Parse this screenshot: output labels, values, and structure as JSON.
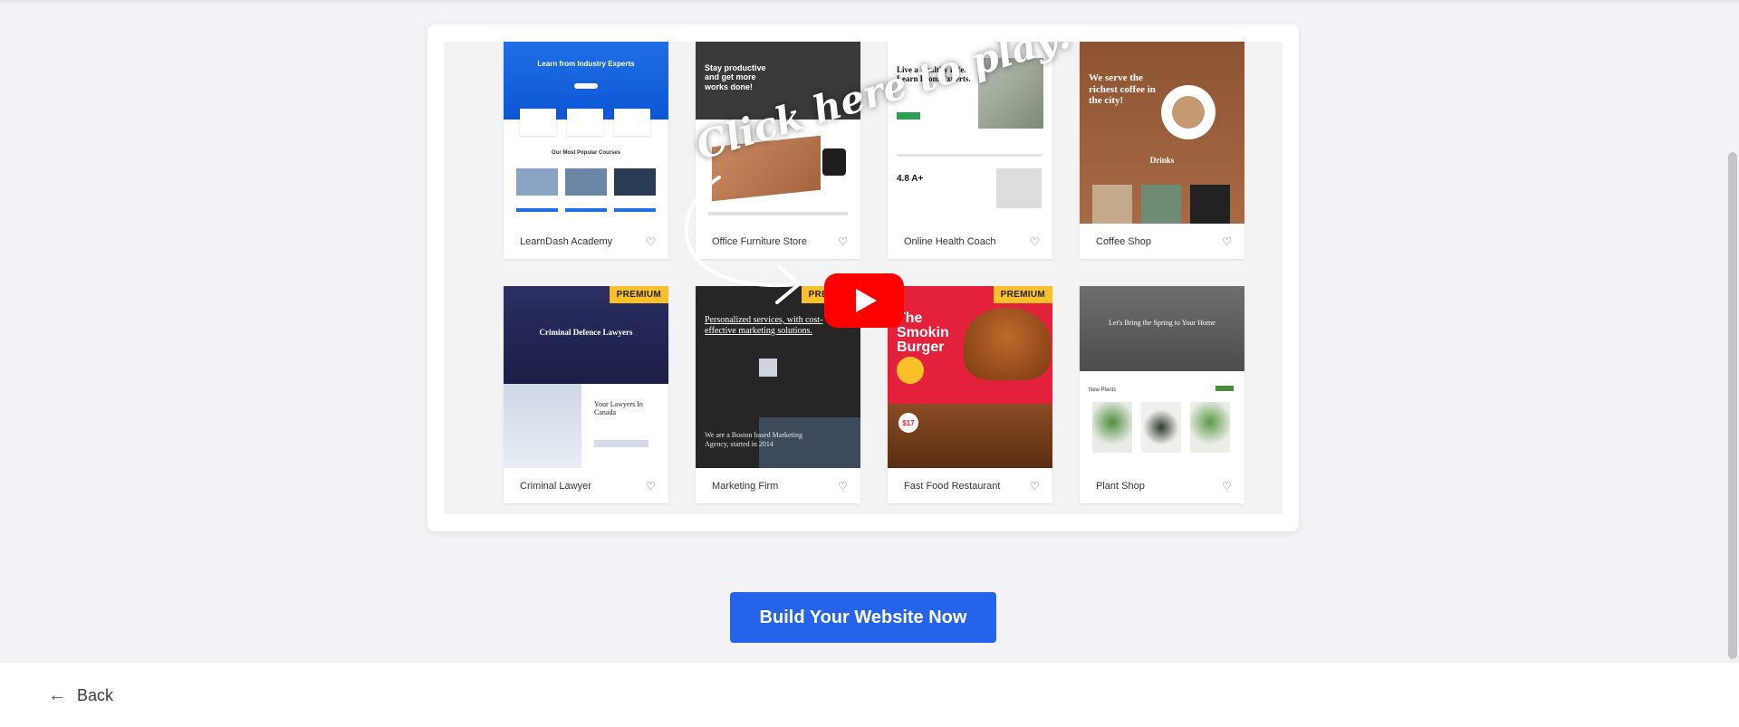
{
  "video": {
    "hint": "Click here to play!",
    "templates": [
      {
        "name": "LearnDash Academy",
        "premium": false,
        "hero": "Learn from Industry Experts",
        "sub": "Our Most Popular Courses"
      },
      {
        "name": "Office Furniture Store",
        "premium": false,
        "hero": "Stay productive and get more works done!",
        "sub": ""
      },
      {
        "name": "Online Health Coach",
        "premium": false,
        "hero": "Live a Healthy Life. Learn From Experts.",
        "sub": "4.8   A+"
      },
      {
        "name": "Coffee Shop",
        "premium": false,
        "hero": "We serve the richest coffee in the city!",
        "sub": "Drinks"
      },
      {
        "name": "Criminal Lawyer",
        "premium": true,
        "hero": "Criminal Defence Lawyers",
        "sub": "Your Lawyers In Canada"
      },
      {
        "name": "Marketing Firm",
        "premium": true,
        "hero": "Personalized services, with cost-effective marketing solutions.",
        "sub": "We are a Boston based Marketing Agency, started in 2014"
      },
      {
        "name": "Fast Food Restaurant",
        "premium": true,
        "hero": "The Smokin Burger",
        "sub": "$17"
      },
      {
        "name": "Plant Shop",
        "premium": false,
        "hero": "Let's Bring the Spring to Your Home",
        "sub": "New Plants"
      }
    ],
    "badge_label": "PREMIUM"
  },
  "cta": {
    "label": "Build Your Website Now"
  },
  "footer": {
    "back_label": "Back"
  },
  "colors": {
    "cta": "#2563eb",
    "badge": "#f8c12a",
    "play": "#ff0000"
  }
}
